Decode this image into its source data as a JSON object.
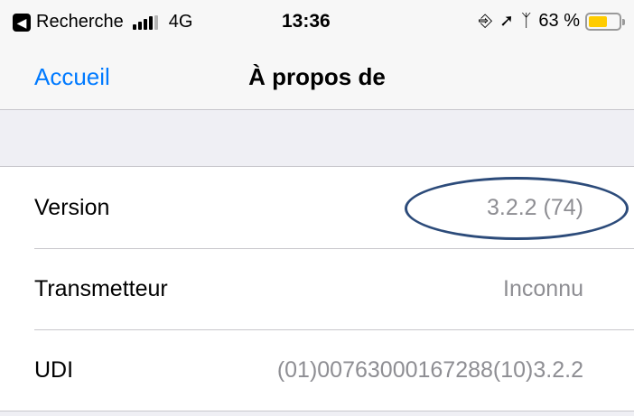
{
  "status_bar": {
    "back_app_icon": "back-arrow-icon",
    "back_app_label": "Recherche",
    "network": "4G",
    "time": "13:36",
    "icons": [
      "orientation-lock-icon",
      "location-arrow-icon",
      "bluetooth-icon"
    ],
    "battery_percent": "63 %",
    "battery_level": 0.63,
    "battery_color": "#ffcc00"
  },
  "nav": {
    "back_label": "Accueil",
    "title": "À propos de"
  },
  "rows": [
    {
      "label": "Version",
      "value": "3.2.2 (74)"
    },
    {
      "label": "Transmetteur",
      "value": "Inconnu"
    },
    {
      "label": "UDI",
      "value": "(01)00763000167288(10)3.2.2"
    }
  ],
  "colors": {
    "link": "#007aff",
    "secondary_text": "#8e8e93",
    "annotation": "#2c4b7a"
  }
}
